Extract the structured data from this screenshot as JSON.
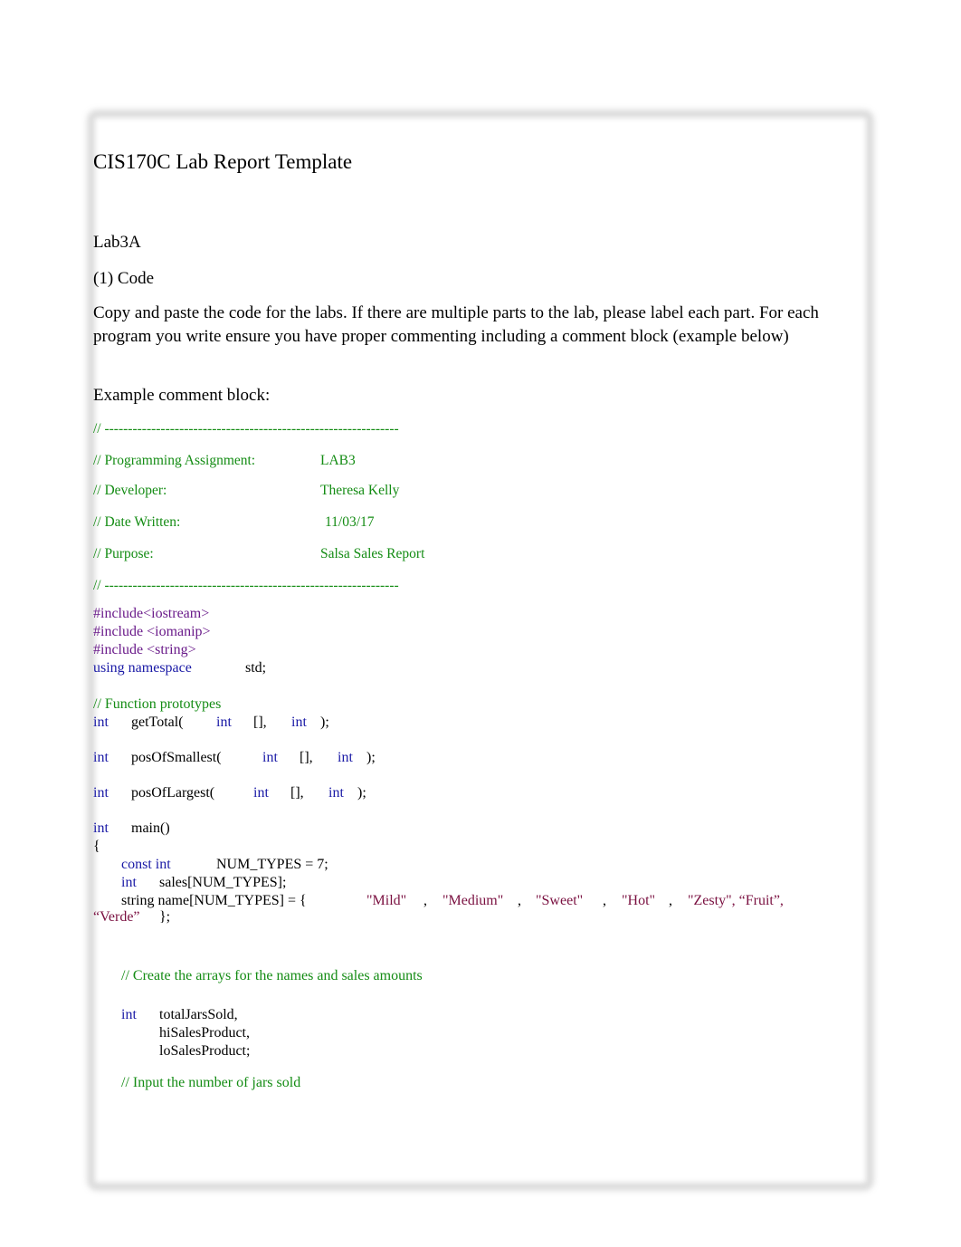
{
  "document": {
    "title": "CIS170C Lab Report Template",
    "lab_name": "Lab3A",
    "section_heading": "(1) Code",
    "instructions": "Copy and paste the code for the labs. If there are multiple parts to the lab, please label each part. For each program you write ensure you have proper commenting including a comment block (example below)",
    "example_label": "Example comment block:"
  },
  "comment_block": {
    "divider": "// ---------------------------------------------------------------",
    "rows": [
      {
        "label": "// Programming Assignment:",
        "value": "LAB3"
      },
      {
        "label": "// Developer:",
        "value": "Theresa Kelly"
      },
      {
        "label": "// Date Written:",
        "value": "11/03/17"
      },
      {
        "label": "// Purpose:",
        "value": "Salsa Sales Report"
      }
    ]
  },
  "code": {
    "includes": [
      "#include<iostream>",
      "#include <iomanip>",
      "#include <string>"
    ],
    "using_kw": "using namespace",
    "using_ns": "std;",
    "proto_comment": "// Function prototypes",
    "kw_int": "int",
    "kw_const_int": "const int",
    "prototypes": [
      {
        "name": "getTotal(",
        "arr": "[],",
        "end": ");"
      },
      {
        "name": "posOfSmallest(",
        "arr": "[],",
        "end": ");"
      },
      {
        "name": "posOfLargest(",
        "arr": "[],",
        "end": ");"
      }
    ],
    "main_sig": "main()",
    "open_brace": "{",
    "num_types_decl": "NUM_TYPES = 7;",
    "sales_decl": "sales[NUM_TYPES];",
    "name_decl": "string name[NUM_TYPES] = {",
    "name_values": [
      "\"Mild\"",
      "\"Medium\"",
      "\"Sweet\"",
      "\"Hot\"",
      "\"Zesty\", “Fruit”,"
    ],
    "comma": ",",
    "name_last": "“Verde”",
    "name_close": "};",
    "arrays_comment": "// Create the arrays for the names and sales amounts",
    "vars": [
      "totalJarsSold,",
      "hiSalesProduct,",
      "loSalesProduct;"
    ],
    "input_comment": "// Input the number of jars sold"
  },
  "colors": {
    "comment": "#148c14",
    "keyword": "#1a1aa6",
    "preprocessor": "#6a1b8a",
    "string": "#7a1040"
  }
}
